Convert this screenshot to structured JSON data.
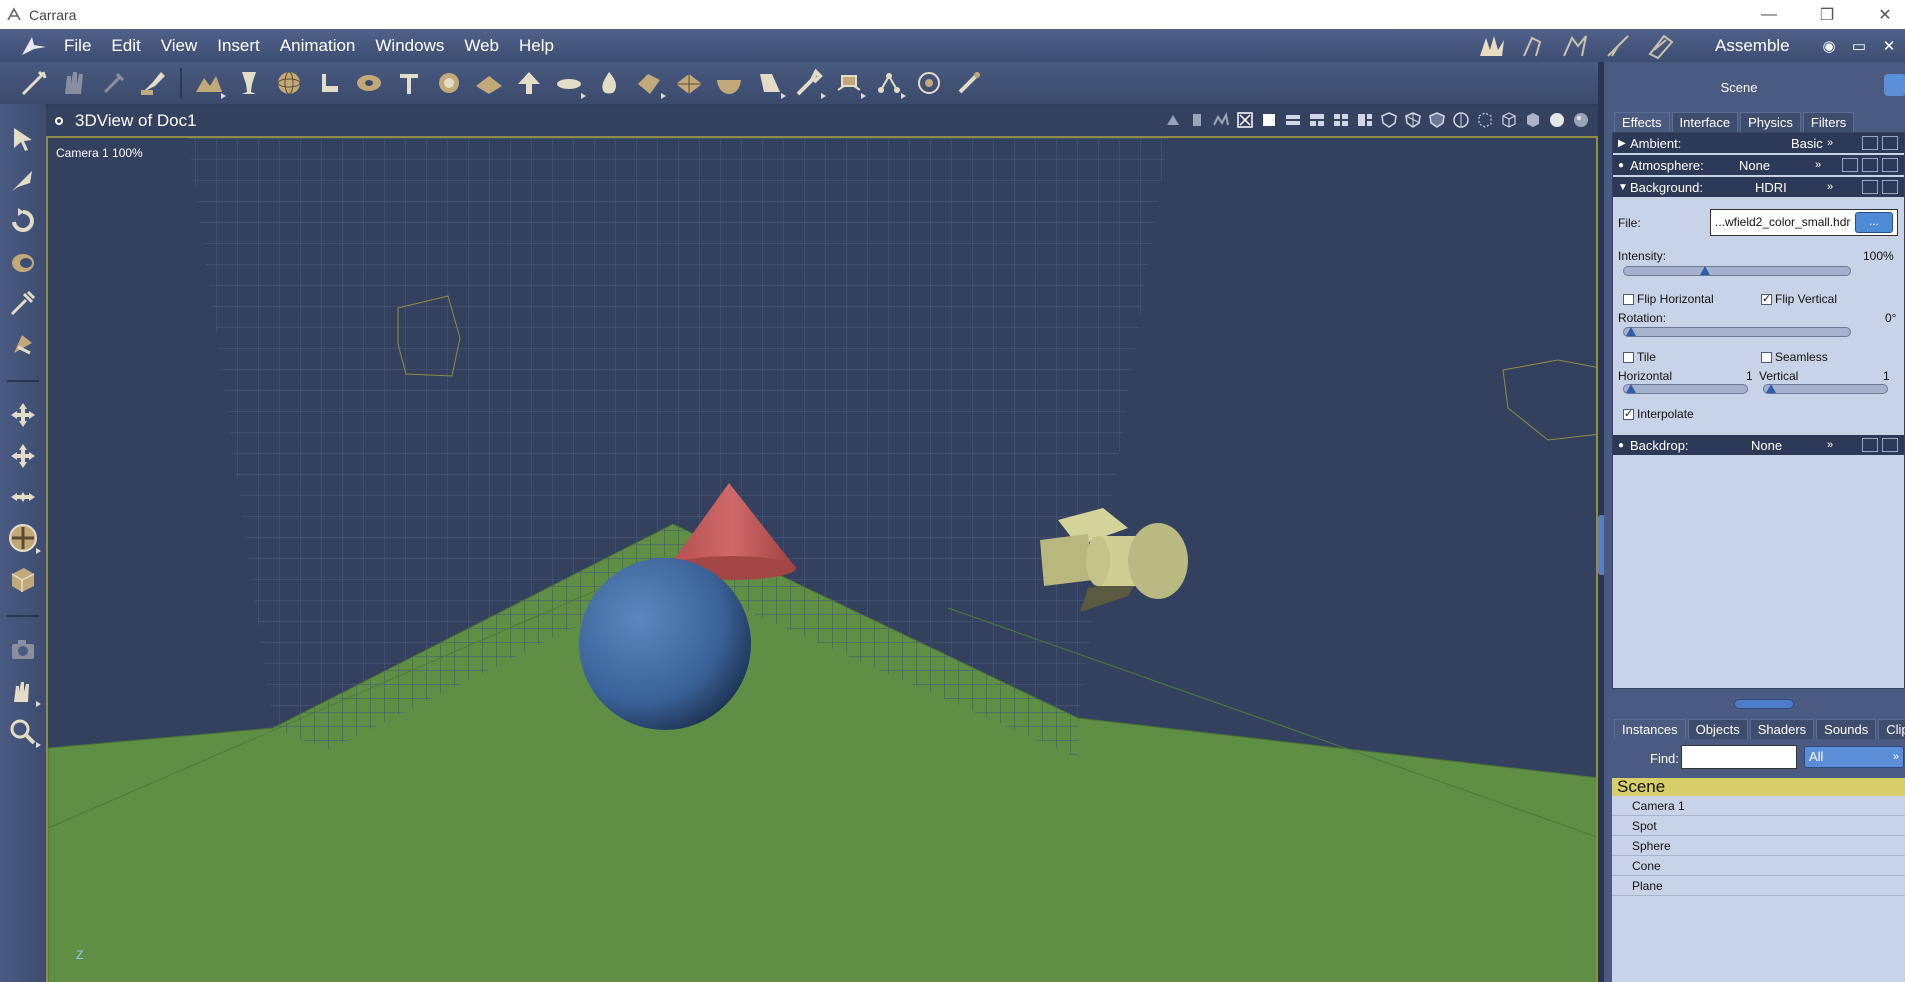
{
  "window": {
    "title": "Carrara",
    "minimize": "—",
    "restore": "❐",
    "close": "✕"
  },
  "menu": {
    "items": [
      "File",
      "Edit",
      "View",
      "Insert",
      "Animation",
      "Windows",
      "Web",
      "Help"
    ]
  },
  "room": {
    "label": "Assemble",
    "ctrl_eye": "◉",
    "ctrl_max": "▭",
    "ctrl_close": "✕"
  },
  "viewport": {
    "title": "3DView of Doc1",
    "camera_label": "Camera 1 100%",
    "axis_label": "Z"
  },
  "scene_panel": {
    "title": "Scene",
    "tabs": [
      "Effects",
      "Interface",
      "Physics",
      "Filters"
    ],
    "ambient": {
      "label": "Ambient:",
      "value": "Basic"
    },
    "atmosphere": {
      "label": "Atmosphere:",
      "value": "None"
    },
    "background": {
      "label": "Background:",
      "value": "HDRI"
    },
    "file": {
      "label": "File:",
      "value": "...wfield2_color_small.hdr",
      "browse_label": "..."
    },
    "intensity": {
      "label": "Intensity:",
      "value": "100%",
      "level": 0.35
    },
    "flip_horizontal": {
      "label": "Flip Horizontal",
      "checked": false
    },
    "flip_vertical": {
      "label": "Flip Vertical",
      "checked": true
    },
    "rotation": {
      "label": "Rotation:",
      "value": "0°",
      "level": 0.0
    },
    "tile": {
      "label": "Tile",
      "checked": false
    },
    "seamless": {
      "label": "Seamless",
      "checked": false
    },
    "horizontal": {
      "label": "Horizontal",
      "value": "1"
    },
    "vertical": {
      "label": "Vertical",
      "value": "1"
    },
    "interpolate": {
      "label": "Interpolate",
      "checked": true
    },
    "backdrop": {
      "label": "Backdrop:",
      "value": "None"
    }
  },
  "browser_panel": {
    "tabs": [
      "Instances",
      "Objects",
      "Shaders",
      "Sounds",
      "Clips"
    ],
    "find_label": "Find:",
    "find_value": "",
    "filter_value": "All",
    "tree_root": "Scene",
    "tree_items": [
      "Camera 1",
      "Spot",
      "Sphere",
      "Cone",
      "Plane"
    ]
  },
  "colors": {
    "floor": "#5f8f45",
    "sphere": "#3f6aa3",
    "cone": "#c25a5a",
    "light": "#d3d39a",
    "selection_border": "#8f8d44",
    "scene_header": "#d9cf69"
  }
}
